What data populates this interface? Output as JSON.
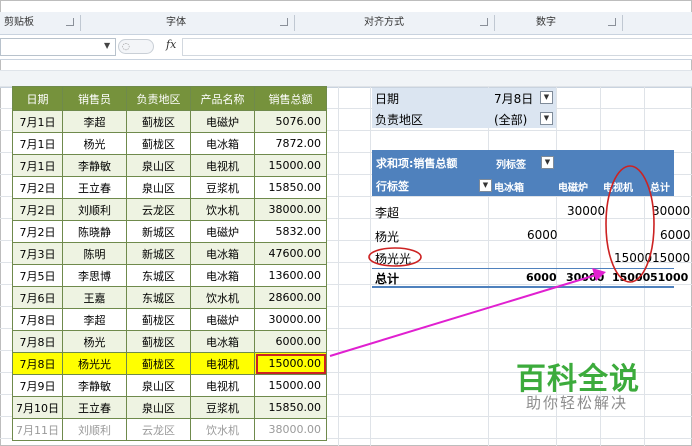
{
  "ribbon": {
    "groups": [
      "剪贴板",
      "字体",
      "对齐方式",
      "数字"
    ]
  },
  "formula_bar": {
    "fx_label": "fx",
    "content": ""
  },
  "table": {
    "headers": [
      "日期",
      "销售员",
      "负责地区",
      "产品名称",
      "销售总额"
    ],
    "rows": [
      [
        "7月1日",
        "李超",
        "蓟栊区",
        "电磁炉",
        "5076.00"
      ],
      [
        "7月1日",
        "杨光",
        "蓟栊区",
        "电冰箱",
        "7872.00"
      ],
      [
        "7月1日",
        "李静敏",
        "泉山区",
        "电视机",
        "15000.00"
      ],
      [
        "7月2日",
        "王立春",
        "泉山区",
        "豆浆机",
        "15850.00"
      ],
      [
        "7月2日",
        "刘顺利",
        "云龙区",
        "饮水机",
        "38000.00"
      ],
      [
        "7月2日",
        "陈晓静",
        "新城区",
        "电磁炉",
        "5832.00"
      ],
      [
        "7月3日",
        "陈明",
        "新城区",
        "电冰箱",
        "47600.00"
      ],
      [
        "7月5日",
        "李思博",
        "东城区",
        "电冰箱",
        "13600.00"
      ],
      [
        "7月6日",
        "王嘉",
        "东城区",
        "饮水机",
        "28600.00"
      ],
      [
        "7月8日",
        "李超",
        "蓟栊区",
        "电磁炉",
        "30000.00"
      ],
      [
        "7月8日",
        "杨光",
        "蓟栊区",
        "电冰箱",
        "6000.00"
      ],
      [
        "7月8日",
        "杨光光",
        "蓟栊区",
        "电视机",
        "15000.00"
      ],
      [
        "7月9日",
        "李静敏",
        "泉山区",
        "电视机",
        "15000.00"
      ],
      [
        "7月10日",
        "王立春",
        "泉山区",
        "豆浆机",
        "15850.00"
      ],
      [
        "7月11日",
        "刘顺利",
        "云龙区",
        "饮水机",
        "38000.00"
      ]
    ]
  },
  "pivot": {
    "filter1_label": "日期",
    "filter1_value": "7月8日",
    "filter2_label": "负责地区",
    "filter2_value": "(全部)",
    "value_label": "求和项:销售总额",
    "col_label": "列标签",
    "row_label": "行标签",
    "columns": [
      "电冰箱",
      "电磁炉",
      "电视机",
      "总计"
    ],
    "rows": [
      {
        "name": "李超",
        "values": [
          "",
          "30000",
          "",
          "30000"
        ]
      },
      {
        "name": "杨光",
        "values": [
          "6000",
          "",
          "",
          "6000"
        ]
      },
      {
        "name": "杨光光",
        "values": [
          "",
          "",
          "15000",
          "15000"
        ]
      }
    ],
    "total_label": "总计",
    "totals": [
      "6000",
      "30000",
      "15000",
      "51000"
    ]
  },
  "watermark": {
    "title": "百科全说",
    "subtitle": "助你轻松解决"
  },
  "colors": {
    "header_green": "#76923c",
    "highlight": "#ffff00",
    "pivot_blue": "#4f81bd",
    "annotation": "#cc2222",
    "arrow": "#e020d0"
  }
}
